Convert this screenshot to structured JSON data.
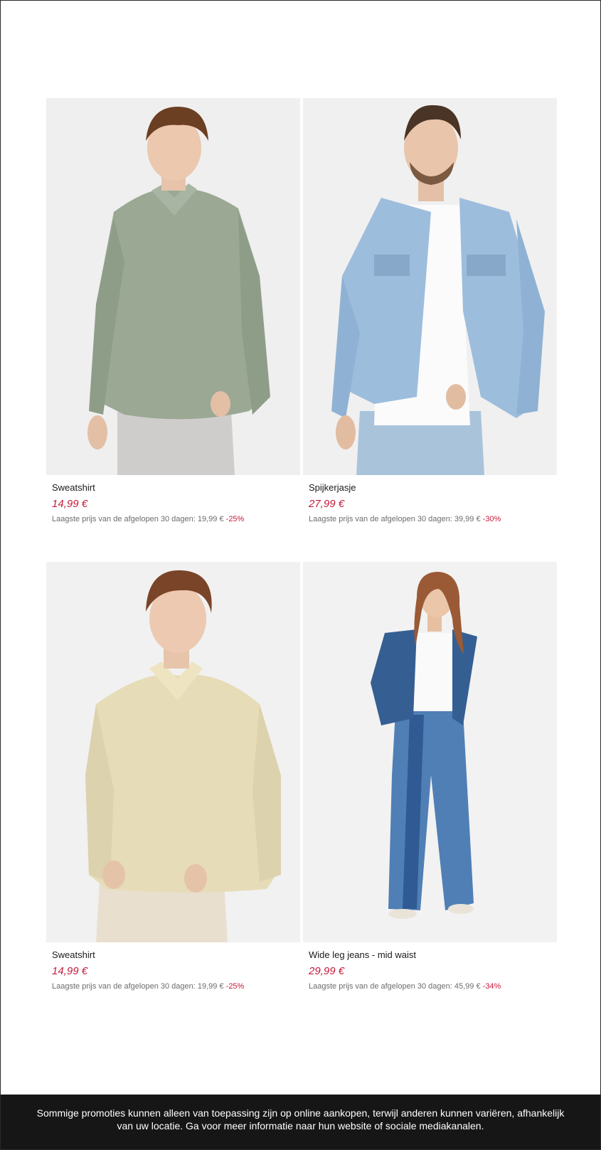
{
  "products": [
    {
      "name": "Sweatshirt",
      "price": "14,99 €",
      "lowest_label": "Laagste prijs van de afgelopen 30 dagen: 19,99 €",
      "discount": "-25%",
      "image": "man-sage-polo-sweatshirt"
    },
    {
      "name": "Spijkerjasje",
      "price": "27,99 €",
      "lowest_label": "Laagste prijs van de afgelopen 30 dagen: 39,99 €",
      "discount": "-30%",
      "image": "man-light-denim-jacket"
    },
    {
      "name": "Sweatshirt",
      "price": "14,99 €",
      "lowest_label": "Laagste prijs van de afgelopen 30 dagen: 19,99 €",
      "discount": "-25%",
      "image": "man-beige-polo-sweatshirt"
    },
    {
      "name": "Wide leg jeans - mid waist",
      "price": "29,99 €",
      "lowest_label": "Laagste prijs van de afgelopen 30 dagen: 45,99 €",
      "discount": "-34%",
      "image": "woman-wide-leg-jeans"
    }
  ],
  "footer": {
    "text": "Sommige promoties kunnen alleen van toepassing zijn op online aankopen, terwijl anderen kunnen variëren, afhankelijk van uw locatie. Ga voor meer informatie naar hun website of sociale mediakanalen."
  },
  "colors": {
    "price": "#c51b3a",
    "footer_bg": "#161616"
  }
}
